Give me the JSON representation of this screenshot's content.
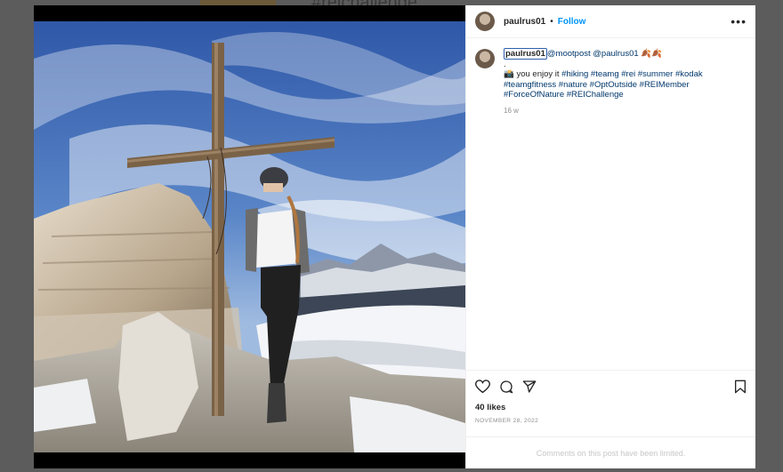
{
  "background": {
    "hashtag_text": "#reichallenge"
  },
  "post": {
    "username": "paulrus01",
    "follow_label": "Follow",
    "separator": "•",
    "more_label": "•••",
    "caption": {
      "username": "paulrus01",
      "segments": [
        {
          "type": "mention",
          "text": "@mootpost"
        },
        {
          "type": "text",
          "text": " "
        },
        {
          "type": "mention",
          "text": "@paulrus01"
        },
        {
          "type": "text",
          "text": " 🍂🍂"
        },
        {
          "type": "br"
        },
        {
          "type": "text",
          "text": "."
        },
        {
          "type": "br"
        },
        {
          "type": "text",
          "text": "📸 you enjoy it "
        },
        {
          "type": "tag",
          "text": "#hiking"
        },
        {
          "type": "text",
          "text": " "
        },
        {
          "type": "tag",
          "text": "#teamg"
        },
        {
          "type": "text",
          "text": " "
        },
        {
          "type": "tag",
          "text": "#rei"
        },
        {
          "type": "text",
          "text": " "
        },
        {
          "type": "tag",
          "text": "#summer"
        },
        {
          "type": "text",
          "text": " "
        },
        {
          "type": "tag",
          "text": "#kodak"
        },
        {
          "type": "text",
          "text": " "
        },
        {
          "type": "tag",
          "text": "#teamgfitness"
        },
        {
          "type": "text",
          "text": " "
        },
        {
          "type": "tag",
          "text": "#nature"
        },
        {
          "type": "text",
          "text": " "
        },
        {
          "type": "tag",
          "text": "#OptOutside"
        },
        {
          "type": "text",
          "text": " "
        },
        {
          "type": "tag",
          "text": "#REIMember"
        },
        {
          "type": "text",
          "text": " "
        },
        {
          "type": "tag",
          "text": "#ForceOfNature"
        },
        {
          "type": "text",
          "text": " "
        },
        {
          "type": "tag",
          "text": "#REIChallenge"
        }
      ],
      "time_ago": "16 w"
    },
    "likes": "40 likes",
    "date": "NOVEMBER 28, 2022",
    "comments_limited": "Comments on this post have been limited.",
    "icons": [
      "heart-icon",
      "comment-icon",
      "share-icon",
      "bookmark-icon"
    ]
  }
}
